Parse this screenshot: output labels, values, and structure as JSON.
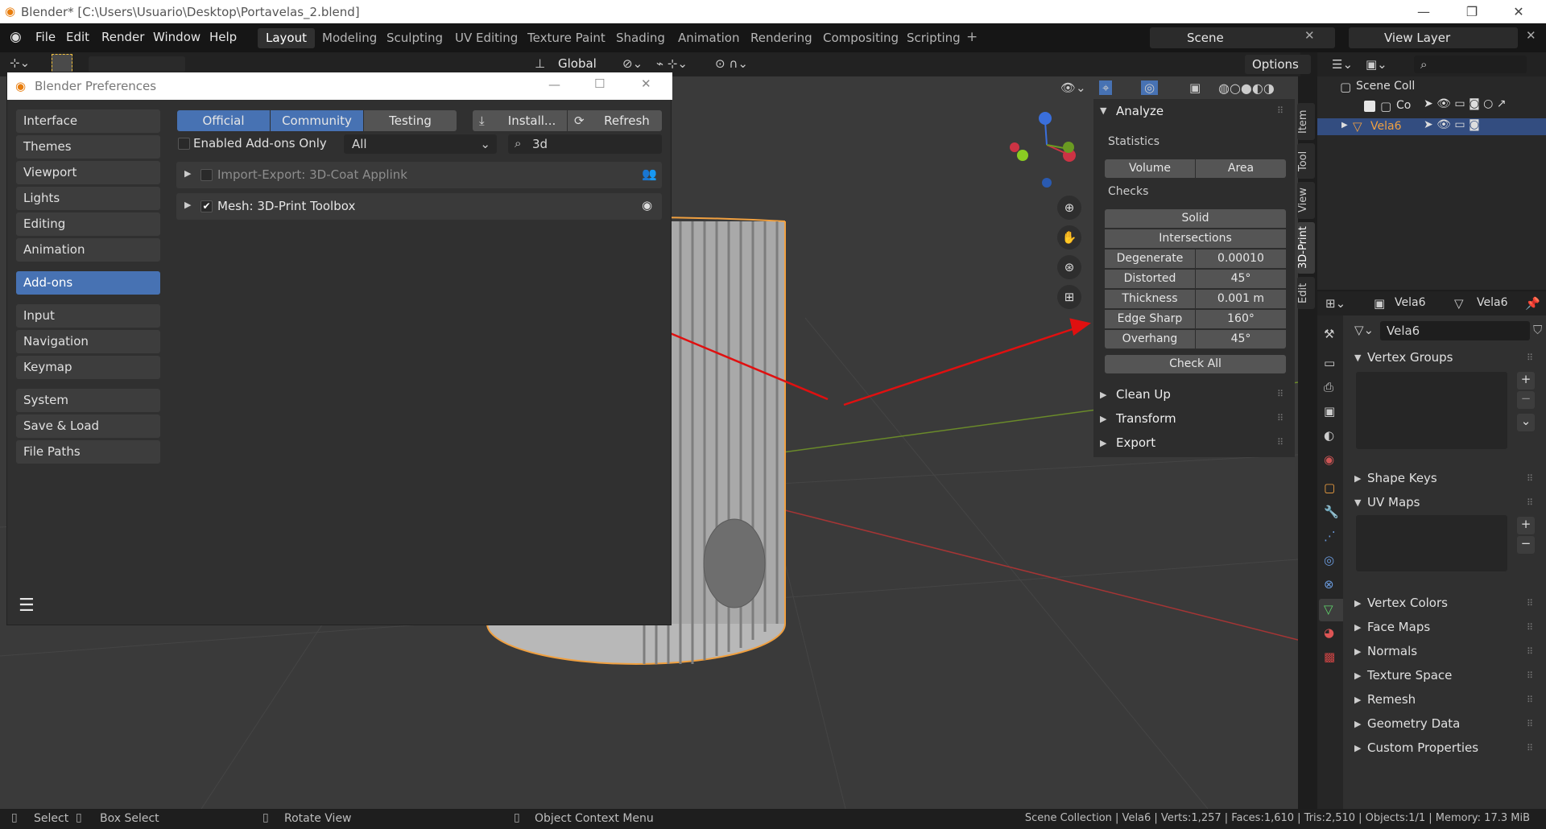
{
  "titlebar": {
    "title": "Blender* [C:\\Users\\Usuario\\Desktop\\Portavelas_2.blend]"
  },
  "menu": [
    "File",
    "Edit",
    "Render",
    "Window",
    "Help"
  ],
  "workspaces": [
    "Layout",
    "Modeling",
    "Sculpting",
    "UV Editing",
    "Texture Paint",
    "Shading",
    "Animation",
    "Rendering",
    "Compositing",
    "Scripting"
  ],
  "scene": {
    "label": "Scene",
    "view_layer": "View Layer"
  },
  "header": {
    "transform": "Global",
    "options": "Options"
  },
  "prefs": {
    "title": "Blender Preferences",
    "categories_a": [
      "Interface",
      "Themes",
      "Viewport",
      "Lights",
      "Editing",
      "Animation"
    ],
    "selected": "Add-ons",
    "categories_b": [
      "Input",
      "Navigation",
      "Keymap"
    ],
    "categories_c": [
      "System",
      "Save & Load",
      "File Paths"
    ],
    "tabs": {
      "official": "Official",
      "community": "Community",
      "testing": "Testing",
      "install": "Install...",
      "refresh": "Refresh"
    },
    "enabled_only": "Enabled Add-ons Only",
    "filter": "All",
    "search": "3d",
    "addons": [
      {
        "name": "Import-Export: 3D-Coat Applink",
        "enabled": false
      },
      {
        "name": "Mesh: 3D-Print Toolbox",
        "enabled": true
      }
    ]
  },
  "npanel": {
    "tabs": [
      "Item",
      "Tool",
      "View",
      "3D-Print",
      "Edit"
    ],
    "analyze": "Analyze",
    "statistics": "Statistics",
    "volume": "Volume",
    "area": "Area",
    "checks": "Checks",
    "solid": "Solid",
    "intersections": "Intersections",
    "rows": [
      {
        "label": "Degenerate",
        "value": "0.00010"
      },
      {
        "label": "Distorted",
        "value": "45°"
      },
      {
        "label": "Thickness",
        "value": "0.001 m"
      },
      {
        "label": "Edge Sharp",
        "value": "160°"
      },
      {
        "label": "Overhang",
        "value": "45°"
      }
    ],
    "check_all": "Check All",
    "sections": [
      "Clean Up",
      "Transform",
      "Export"
    ]
  },
  "outliner": {
    "collection": "Scene Coll",
    "sub": "Co",
    "object": "Vela6"
  },
  "properties": {
    "object": "Vela6",
    "mesh": "Vela6",
    "data_name": "Vela6",
    "vertex_groups": "Vertex Groups",
    "shape_keys": "Shape Keys",
    "uv_maps": "UV Maps",
    "sections": [
      "Vertex Colors",
      "Face Maps",
      "Normals",
      "Texture Space",
      "Remesh",
      "Geometry Data",
      "Custom Properties"
    ]
  },
  "status": {
    "select": "Select",
    "box_select": "Box Select",
    "rotate": "Rotate View",
    "context": "Object Context Menu",
    "info": "Scene Collection | Vela6 | Verts:1,257 | Faces:1,610 | Tris:2,510 | Objects:1/1 | Memory: 17.3 MiB"
  },
  "colors": {
    "accent": "#4772b3",
    "annotation": "#e01010",
    "selection_outline": "#f0a040"
  }
}
